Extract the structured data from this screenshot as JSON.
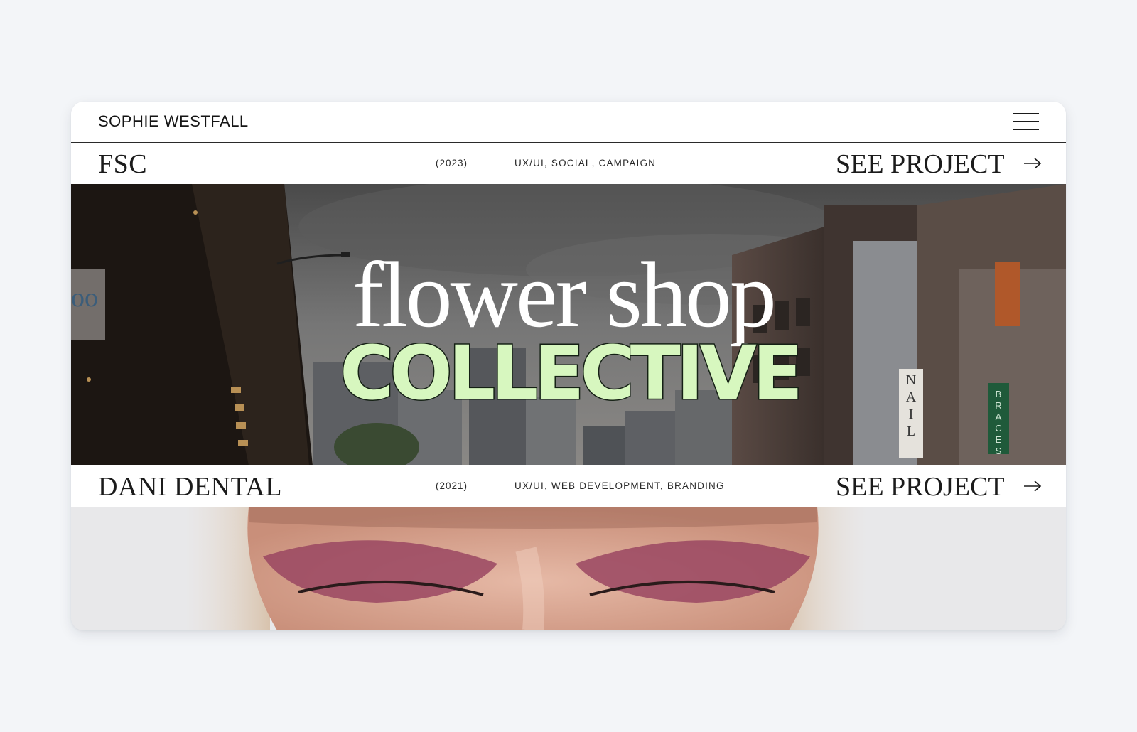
{
  "header": {
    "brand": "SOPHIE WESTFALL",
    "menu_icon": "hamburger-menu-icon"
  },
  "projects": [
    {
      "title": "FSC",
      "year": "(2023)",
      "tags": "UX/UI, SOCIAL, CAMPAIGN",
      "link_label": "SEE PROJECT",
      "arrow_icon": "arrow-right-icon",
      "hero": {
        "title": "flower shop",
        "subtitle": "COLLECTIVE",
        "subtitle_color": "#d7f7bf",
        "sign_nail": "NAIL",
        "sign_braces": "BRACES"
      }
    },
    {
      "title": "DANI DENTAL",
      "year": "(2021)",
      "tags": "UX/UI, WEB DEVELOPMENT, BRANDING",
      "link_label": "SEE PROJECT",
      "arrow_icon": "arrow-right-icon"
    }
  ],
  "colors": {
    "background": "#f3f5f8",
    "card": "#ffffff",
    "text": "#1b1b1b",
    "accent_green": "#d7f7bf"
  }
}
